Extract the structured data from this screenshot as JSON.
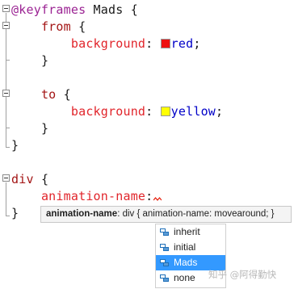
{
  "code": {
    "keyframes_keyword": "@keyframes",
    "keyframes_name": "Mads",
    "from_keyword": "from",
    "to_keyword": "to",
    "background_property": "background",
    "from_value": "red",
    "to_value": "yellow",
    "selector": "div",
    "animation_property": "animation-name",
    "open_brace": "{",
    "close_brace": "}",
    "colon": ":",
    "semicolon": ";"
  },
  "swatch_colors": {
    "red": "#ee1111",
    "yellow": "#ffff00"
  },
  "tooltip": {
    "property": "animation-name",
    "description": ": div { animation-name: movearound; }"
  },
  "completion": {
    "items": [
      "inherit",
      "initial",
      "Mads",
      "none"
    ],
    "selected": "Mads",
    "icon": "property-value-icon"
  },
  "watermark": {
    "text": "知乎 @阿得勤快"
  },
  "theme": {
    "at_rule": "#9b2393",
    "keyword": "#a31515",
    "property": "#e1252b",
    "value": "#0000c8",
    "selection": "#3399ff"
  }
}
